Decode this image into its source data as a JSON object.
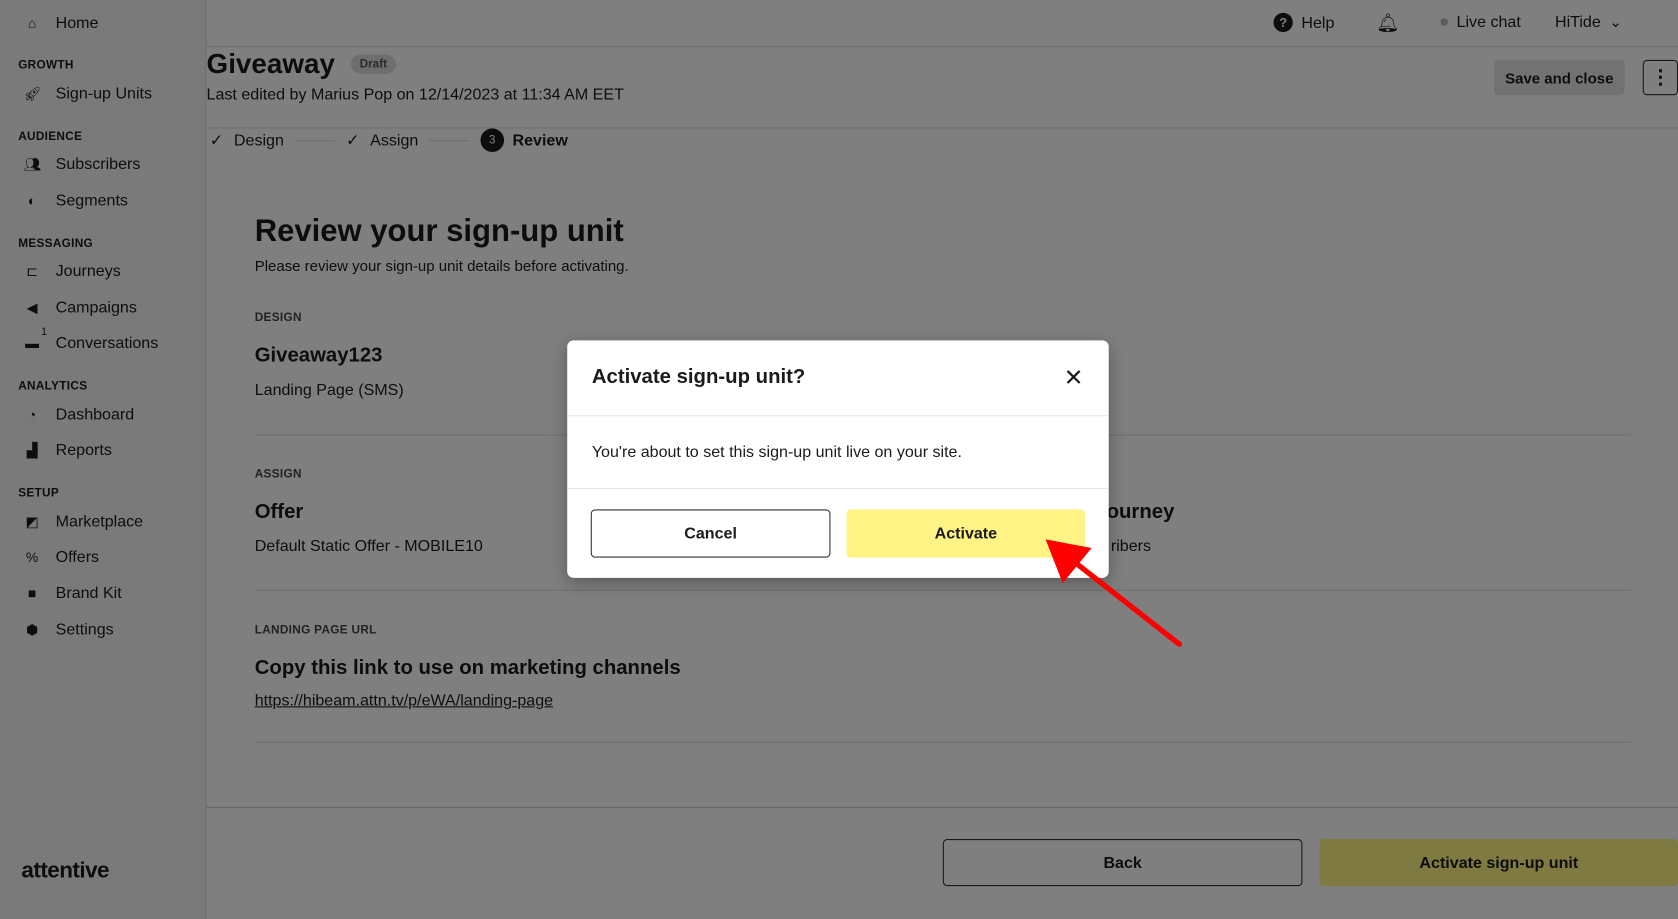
{
  "sidebar": {
    "home": "Home",
    "sections": [
      {
        "title": "GROWTH",
        "items": [
          {
            "label": "Sign-up Units",
            "icon": "rocket-icon"
          }
        ]
      },
      {
        "title": "AUDIENCE",
        "items": [
          {
            "label": "Subscribers",
            "icon": "users-icon"
          },
          {
            "label": "Segments",
            "icon": "segments-icon"
          }
        ]
      },
      {
        "title": "MESSAGING",
        "items": [
          {
            "label": "Journeys",
            "icon": "journeys-icon"
          },
          {
            "label": "Campaigns",
            "icon": "megaphone-icon"
          },
          {
            "label": "Conversations",
            "icon": "chat-icon",
            "badge": "1"
          }
        ]
      },
      {
        "title": "ANALYTICS",
        "items": [
          {
            "label": "Dashboard",
            "icon": "pie-icon"
          },
          {
            "label": "Reports",
            "icon": "bar-chart-icon"
          }
        ]
      },
      {
        "title": "SETUP",
        "items": [
          {
            "label": "Marketplace",
            "icon": "marketplace-icon"
          },
          {
            "label": "Offers",
            "icon": "percent-icon"
          },
          {
            "label": "Brand Kit",
            "icon": "shapes-icon"
          },
          {
            "label": "Settings",
            "icon": "gear-icon"
          }
        ]
      }
    ],
    "logo": "attentive"
  },
  "topbar": {
    "help": "Help",
    "live_chat": "Live chat",
    "account": "HiTide"
  },
  "header": {
    "title": "Giveaway",
    "badge": "Draft",
    "subtitle": "Last edited by Marius Pop on 12/14/2023 at 11:34 AM EET",
    "save_close": "Save and close",
    "more": "⋮"
  },
  "steps": [
    {
      "label": "Design",
      "state": "done"
    },
    {
      "label": "Assign",
      "state": "done"
    },
    {
      "label": "Review",
      "state": "current",
      "number": "3"
    }
  ],
  "main": {
    "title": "Review your sign-up unit",
    "subtitle": "Please review your sign-up unit details before activating.",
    "design_label": "DESIGN",
    "design_name": "Giveaway123",
    "design_type": "Landing Page (SMS)",
    "assign_label": "ASSIGN",
    "offer_title": "Offer",
    "offer_value": "Default Static Offer - MOBILE10",
    "journey_title_partial": "ourney",
    "journey_value_partial": "ribers",
    "url_label": "LANDING PAGE URL",
    "url_title": "Copy this link to use on marketing channels",
    "url": "https://hibeam.attn.tv/p/eWA/landing-page"
  },
  "footer": {
    "back": "Back",
    "activate": "Activate sign-up unit"
  },
  "modal": {
    "title": "Activate sign-up unit?",
    "body": "You're about to set this sign-up unit live on your site.",
    "cancel": "Cancel",
    "activate": "Activate"
  },
  "colors": {
    "accent_yellow": "#fff385",
    "annotation_arrow": "#ff0000"
  }
}
